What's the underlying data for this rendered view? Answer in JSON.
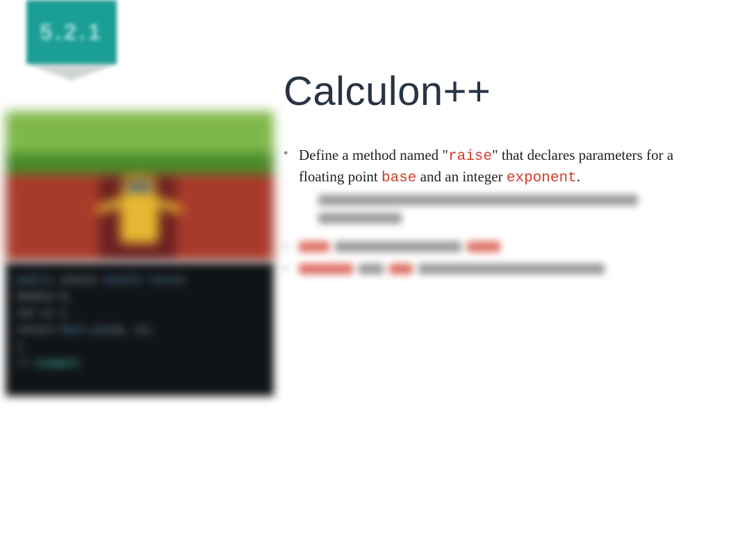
{
  "badge": {
    "version": "5.2.1"
  },
  "title": "Calculon++",
  "bullet_1": {
    "pre1": "Define a method named \"",
    "code1": "raise",
    "mid1": "\" that declares parameters for a floating point ",
    "code2": "base",
    "mid2": " and an integer ",
    "code3": "exponent",
    "post": "."
  },
  "terminal": {
    "l1a": "public",
    "l1b": " static ",
    "l1c": "double raise",
    "l1d": "(",
    "l2": "    double b,",
    "l3": "    int e) {",
    "l4a": "  return ",
    "l4b": "Math.pow",
    "l4c": "(b, e);",
    "l5": "}",
    "l6a": "// ",
    "l6b": "example"
  }
}
